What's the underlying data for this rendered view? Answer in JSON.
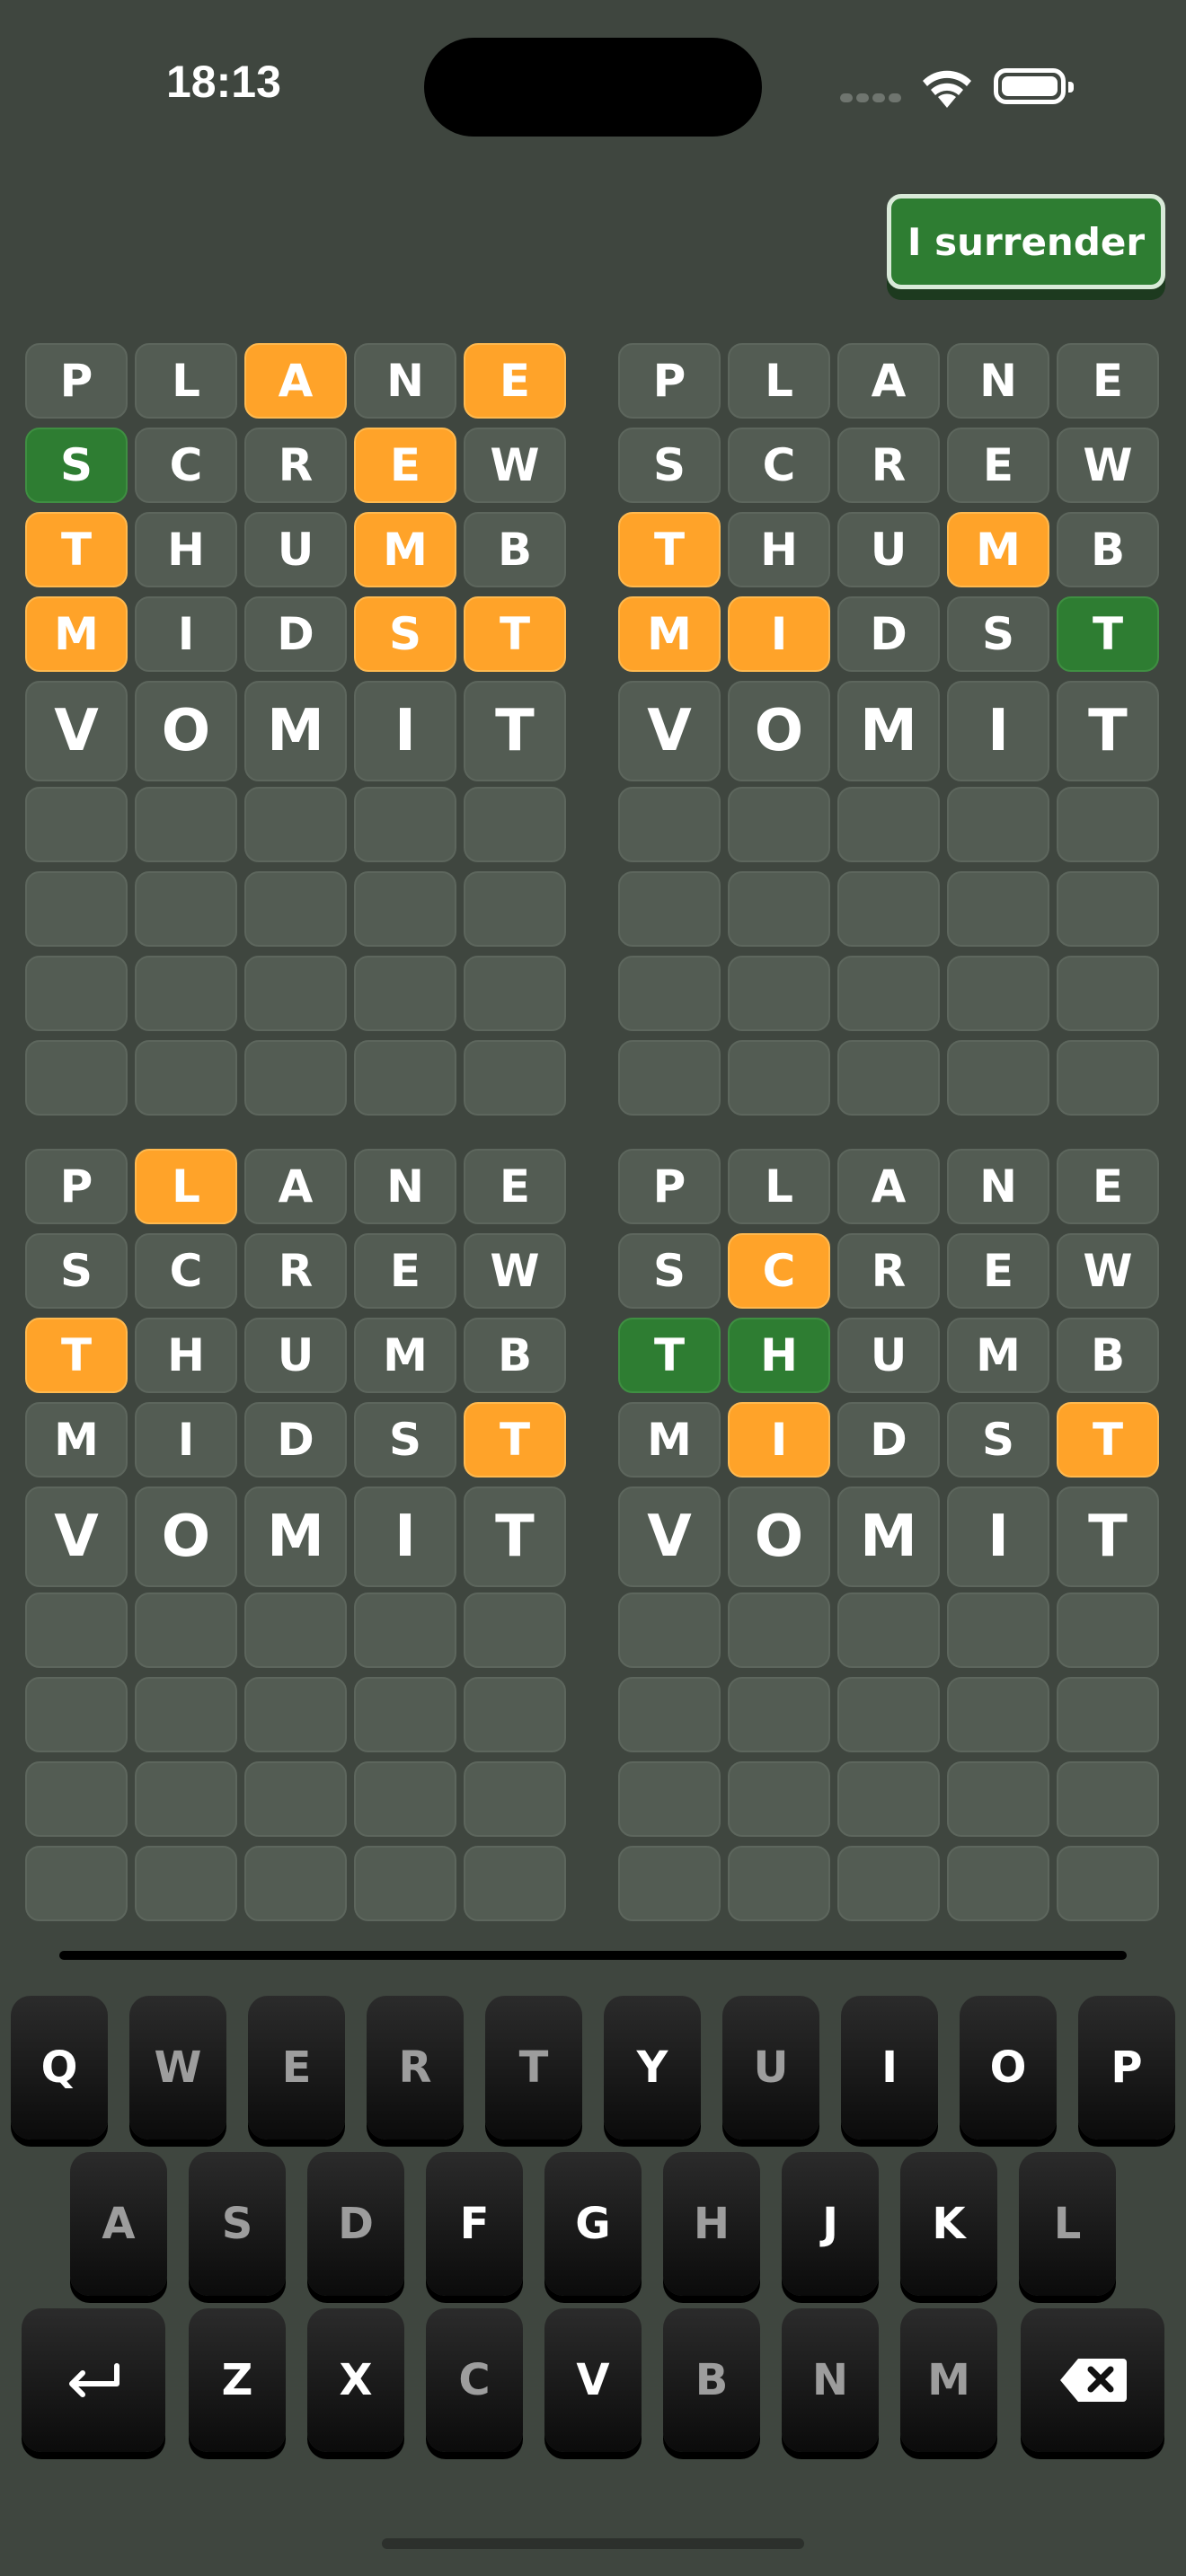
{
  "status": {
    "time": "18:13"
  },
  "surrender_label": "I surrender",
  "boards": [
    {
      "guesses": [
        [
          [
            "P",
            "n"
          ],
          [
            "L",
            "n"
          ],
          [
            "A",
            "o"
          ],
          [
            "N",
            "n"
          ],
          [
            "E",
            "o"
          ]
        ],
        [
          [
            "S",
            "g"
          ],
          [
            "C",
            "n"
          ],
          [
            "R",
            "n"
          ],
          [
            "E",
            "o"
          ],
          [
            "W",
            "n"
          ]
        ],
        [
          [
            "T",
            "o"
          ],
          [
            "H",
            "n"
          ],
          [
            "U",
            "n"
          ],
          [
            "M",
            "o"
          ],
          [
            "B",
            "n"
          ]
        ],
        [
          [
            "M",
            "o"
          ],
          [
            "I",
            "n"
          ],
          [
            "D",
            "n"
          ],
          [
            "S",
            "o"
          ],
          [
            "T",
            "o"
          ]
        ]
      ]
    },
    {
      "guesses": [
        [
          [
            "P",
            "n"
          ],
          [
            "L",
            "n"
          ],
          [
            "A",
            "n"
          ],
          [
            "N",
            "n"
          ],
          [
            "E",
            "n"
          ]
        ],
        [
          [
            "S",
            "n"
          ],
          [
            "C",
            "n"
          ],
          [
            "R",
            "n"
          ],
          [
            "E",
            "n"
          ],
          [
            "W",
            "n"
          ]
        ],
        [
          [
            "T",
            "o"
          ],
          [
            "H",
            "n"
          ],
          [
            "U",
            "n"
          ],
          [
            "M",
            "o"
          ],
          [
            "B",
            "n"
          ]
        ],
        [
          [
            "M",
            "o"
          ],
          [
            "I",
            "o"
          ],
          [
            "D",
            "n"
          ],
          [
            "S",
            "n"
          ],
          [
            "T",
            "g"
          ]
        ]
      ]
    },
    {
      "guesses": [
        [
          [
            "P",
            "n"
          ],
          [
            "L",
            "o"
          ],
          [
            "A",
            "n"
          ],
          [
            "N",
            "n"
          ],
          [
            "E",
            "n"
          ]
        ],
        [
          [
            "S",
            "n"
          ],
          [
            "C",
            "n"
          ],
          [
            "R",
            "n"
          ],
          [
            "E",
            "n"
          ],
          [
            "W",
            "n"
          ]
        ],
        [
          [
            "T",
            "o"
          ],
          [
            "H",
            "n"
          ],
          [
            "U",
            "n"
          ],
          [
            "M",
            "n"
          ],
          [
            "B",
            "n"
          ]
        ],
        [
          [
            "M",
            "n"
          ],
          [
            "I",
            "n"
          ],
          [
            "D",
            "n"
          ],
          [
            "S",
            "n"
          ],
          [
            "T",
            "o"
          ]
        ]
      ]
    },
    {
      "guesses": [
        [
          [
            "P",
            "n"
          ],
          [
            "L",
            "n"
          ],
          [
            "A",
            "n"
          ],
          [
            "N",
            "n"
          ],
          [
            "E",
            "n"
          ]
        ],
        [
          [
            "S",
            "n"
          ],
          [
            "C",
            "o"
          ],
          [
            "R",
            "n"
          ],
          [
            "E",
            "n"
          ],
          [
            "W",
            "n"
          ]
        ],
        [
          [
            "T",
            "g"
          ],
          [
            "H",
            "g"
          ],
          [
            "U",
            "n"
          ],
          [
            "M",
            "n"
          ],
          [
            "B",
            "n"
          ]
        ],
        [
          [
            "M",
            "n"
          ],
          [
            "I",
            "o"
          ],
          [
            "D",
            "n"
          ],
          [
            "S",
            "n"
          ],
          [
            "T",
            "o"
          ]
        ]
      ]
    }
  ],
  "current_word": [
    "V",
    "O",
    "M",
    "I",
    "T"
  ],
  "empty_rows": 4,
  "colors": {
    "orange": "#ffa329",
    "green": "#2e7d32",
    "tile": "#535c53",
    "background": "#3f463f"
  },
  "keyboard": {
    "rows": [
      [
        "Q",
        "W",
        "E",
        "R",
        "T",
        "Y",
        "U",
        "I",
        "O",
        "P"
      ],
      [
        "A",
        "S",
        "D",
        "F",
        "G",
        "H",
        "J",
        "K",
        "L"
      ],
      [
        "Z",
        "X",
        "C",
        "V",
        "B",
        "N",
        "M"
      ]
    ],
    "dim_keys": [
      "W",
      "E",
      "R",
      "T",
      "U",
      "A",
      "S",
      "D",
      "H",
      "L",
      "C",
      "B",
      "N",
      "M"
    ],
    "enter_icon": "enter-icon",
    "backspace_icon": "backspace-icon"
  }
}
